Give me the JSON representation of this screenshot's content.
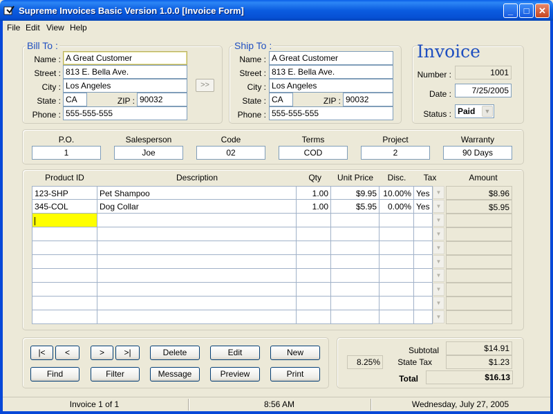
{
  "window": {
    "title": "Supreme Invoices Basic Version 1.0.0  [Invoice Form]",
    "min_glyph": "_",
    "max_glyph": "□",
    "close_glyph": "✕"
  },
  "menu": [
    "File",
    "Edit",
    "View",
    "Help"
  ],
  "bill_to": {
    "legend": "Bill To :",
    "labels": {
      "name": "Name :",
      "street": "Street :",
      "city": "City :",
      "state": "State :",
      "zip": "ZIP :",
      "phone": "Phone :"
    },
    "name": "A Great Customer",
    "street": "813 E. Bella Ave.",
    "city": "Los Angeles",
    "state": "CA",
    "zip": "90032",
    "phone": "555-555-555"
  },
  "copy_button": ">>",
  "ship_to": {
    "legend": "Ship To :",
    "labels": {
      "name": "Name :",
      "street": "Street :",
      "city": "City :",
      "state": "State :",
      "zip": "ZIP :",
      "phone": "Phone :"
    },
    "name": "A Great Customer",
    "street": "813 E. Bella Ave.",
    "city": "Los Angeles",
    "state": "CA",
    "zip": "90032",
    "phone": "555-555-555"
  },
  "invoice": {
    "title": "Invoice",
    "number_label": "Number :",
    "number": "1001",
    "date_label": "Date :",
    "date": "7/25/2005",
    "status_label": "Status :",
    "status": "Paid"
  },
  "details": [
    {
      "label": "P.O.",
      "value": "1"
    },
    {
      "label": "Salesperson",
      "value": "Joe"
    },
    {
      "label": "Code",
      "value": "02"
    },
    {
      "label": "Terms",
      "value": "COD"
    },
    {
      "label": "Project",
      "value": "2"
    },
    {
      "label": "Warranty",
      "value": "90 Days"
    }
  ],
  "grid": {
    "headers": [
      "Product ID",
      "Description",
      "Qty",
      "Unit Price",
      "Disc.",
      "Tax",
      "Amount"
    ],
    "rows": [
      {
        "product_id": "123-SHP",
        "description": "Pet Shampoo",
        "qty": "1.00",
        "unit_price": "$9.95",
        "disc": "10.00%",
        "tax": "Yes",
        "amount": "$8.96"
      },
      {
        "product_id": "345-COL",
        "description": "Dog Collar",
        "qty": "1.00",
        "unit_price": "$5.95",
        "disc": "0.00%",
        "tax": "Yes",
        "amount": "$5.95"
      }
    ],
    "empty_rows": 8
  },
  "buttons": {
    "first": "|<",
    "prev": "<",
    "next": ">",
    "last": ">|",
    "delete": "Delete",
    "edit": "Edit",
    "new": "New",
    "find": "Find",
    "filter": "Filter",
    "message": "Message",
    "preview": "Preview",
    "print": "Print"
  },
  "totals": {
    "subtotal_label": "Subtotal",
    "subtotal": "$14.91",
    "tax_rate": "8.25%",
    "state_tax_label": "State Tax",
    "state_tax": "$1.23",
    "total_label": "Total",
    "total": "$16.13"
  },
  "status_bar": {
    "record": "Invoice 1 of 1",
    "time": "8:56 AM",
    "date": "Wednesday, July 27, 2005"
  }
}
